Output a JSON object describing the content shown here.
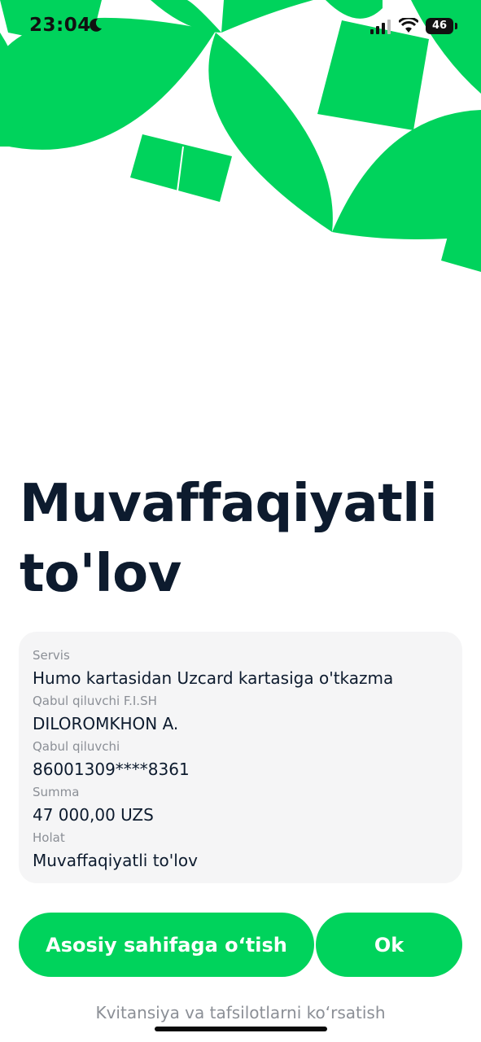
{
  "status_bar": {
    "time": "23:04",
    "battery": "46"
  },
  "colors": {
    "accent": "#00d35c",
    "title": "#0d1b2e",
    "muted": "#8b8f96",
    "card_bg": "#f5f5f6"
  },
  "icons": [
    "moon-icon",
    "signal-icon",
    "wifi-icon",
    "battery-icon"
  ],
  "title": "Muvaffaqiyatli to'lov",
  "details": [
    {
      "label": "Servis",
      "value": "Humo kartasidan Uzcard kartasiga o'tkazma"
    },
    {
      "label": "Qabul qiluvchi F.I.SH",
      "value": "DILOROMKHON A."
    },
    {
      "label": "Qabul qiluvchi",
      "value": "86001309****8361"
    },
    {
      "label": "Summa",
      "value": "47 000,00 UZS"
    },
    {
      "label": "Holat",
      "value": "Muvaffaqiyatli to'lov"
    }
  ],
  "actions": {
    "home_label": "Asosiy sahifaga o‘tish",
    "ok_label": "Ok"
  },
  "receipt_link": "Kvitansiya va tafsilotlarni ko‘rsatish"
}
